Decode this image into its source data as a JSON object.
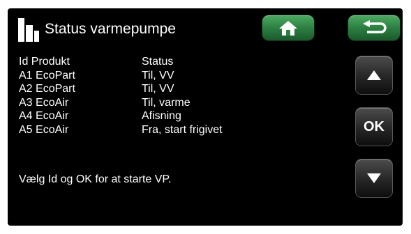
{
  "header": {
    "title": "Status varmepumpe"
  },
  "icons": {
    "logo": "brand-logo-icon",
    "home": "home-icon",
    "back": "back-arrow-icon",
    "up": "arrow-up-icon",
    "down": "arrow-down-icon"
  },
  "colors": {
    "screen_background": "#000000",
    "nav_button_green": "#3a9150",
    "text": "#ffffff"
  },
  "table": {
    "header": {
      "id": "Id Produkt",
      "status": "Status"
    },
    "rows": [
      {
        "id": "A1 EcoPart",
        "status": "Til, VV"
      },
      {
        "id": "A2 EcoPart",
        "status": "Til, VV"
      },
      {
        "id": "A3 EcoAir",
        "status": "Til, varme"
      },
      {
        "id": "A4 EcoAir",
        "status": "Afisning"
      },
      {
        "id": "A5 EcoAir",
        "status": "Fra, start frigivet"
      }
    ]
  },
  "instruction": "Vælg Id og OK for at starte VP.",
  "buttons": {
    "ok_label": "OK"
  }
}
